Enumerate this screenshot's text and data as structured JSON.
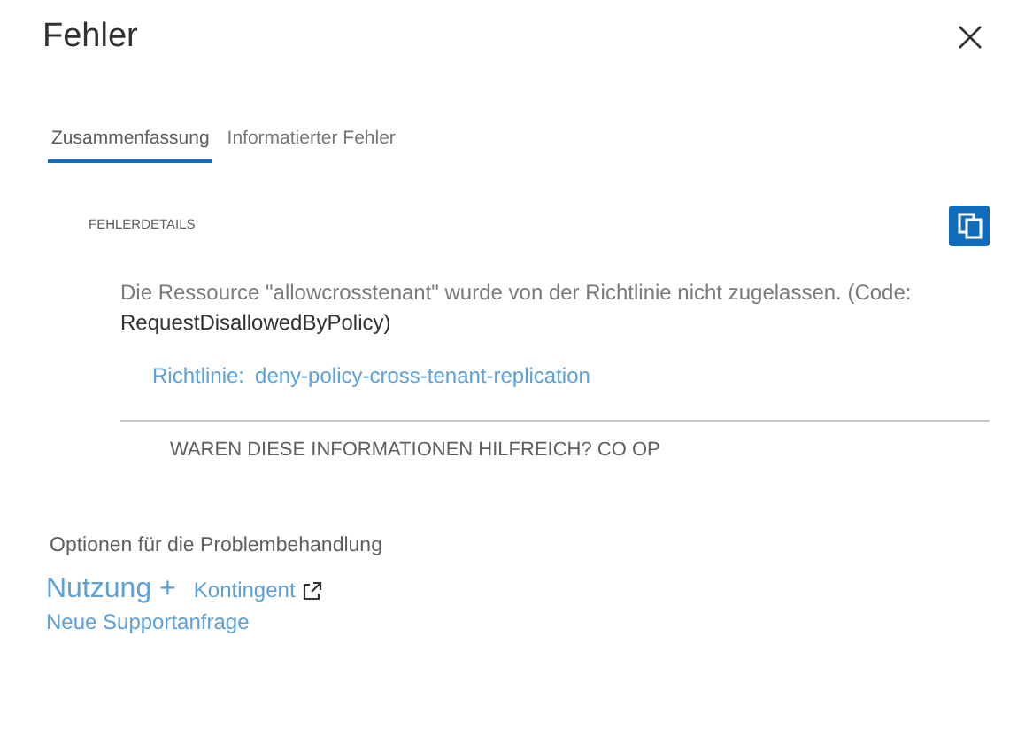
{
  "panel": {
    "title": "Fehler"
  },
  "tabs": [
    {
      "label": "Zusammenfassung",
      "selected": true
    },
    {
      "label": "Informatierter Fehler",
      "selected": false
    }
  ],
  "details": {
    "heading": "FEHLERDETAILS",
    "message": "Die Ressource \"allowcrosstenant\" wurde von der Richtlinie nicht zugelassen. (Code:",
    "code": "RequestDisallowedByPolicy)",
    "policy_label": "Richtlinie:",
    "policy_link": "deny-policy-cross-tenant-replication",
    "feedback": "WAREN DIESE INFORMATIONEN HILFREICH? CO OP"
  },
  "troubleshooting": {
    "heading": "Optionen für die Problembehandlung",
    "links": [
      "Nutzung +",
      "Kontingent"
    ],
    "support_link": "Neue Supportanfrage"
  }
}
